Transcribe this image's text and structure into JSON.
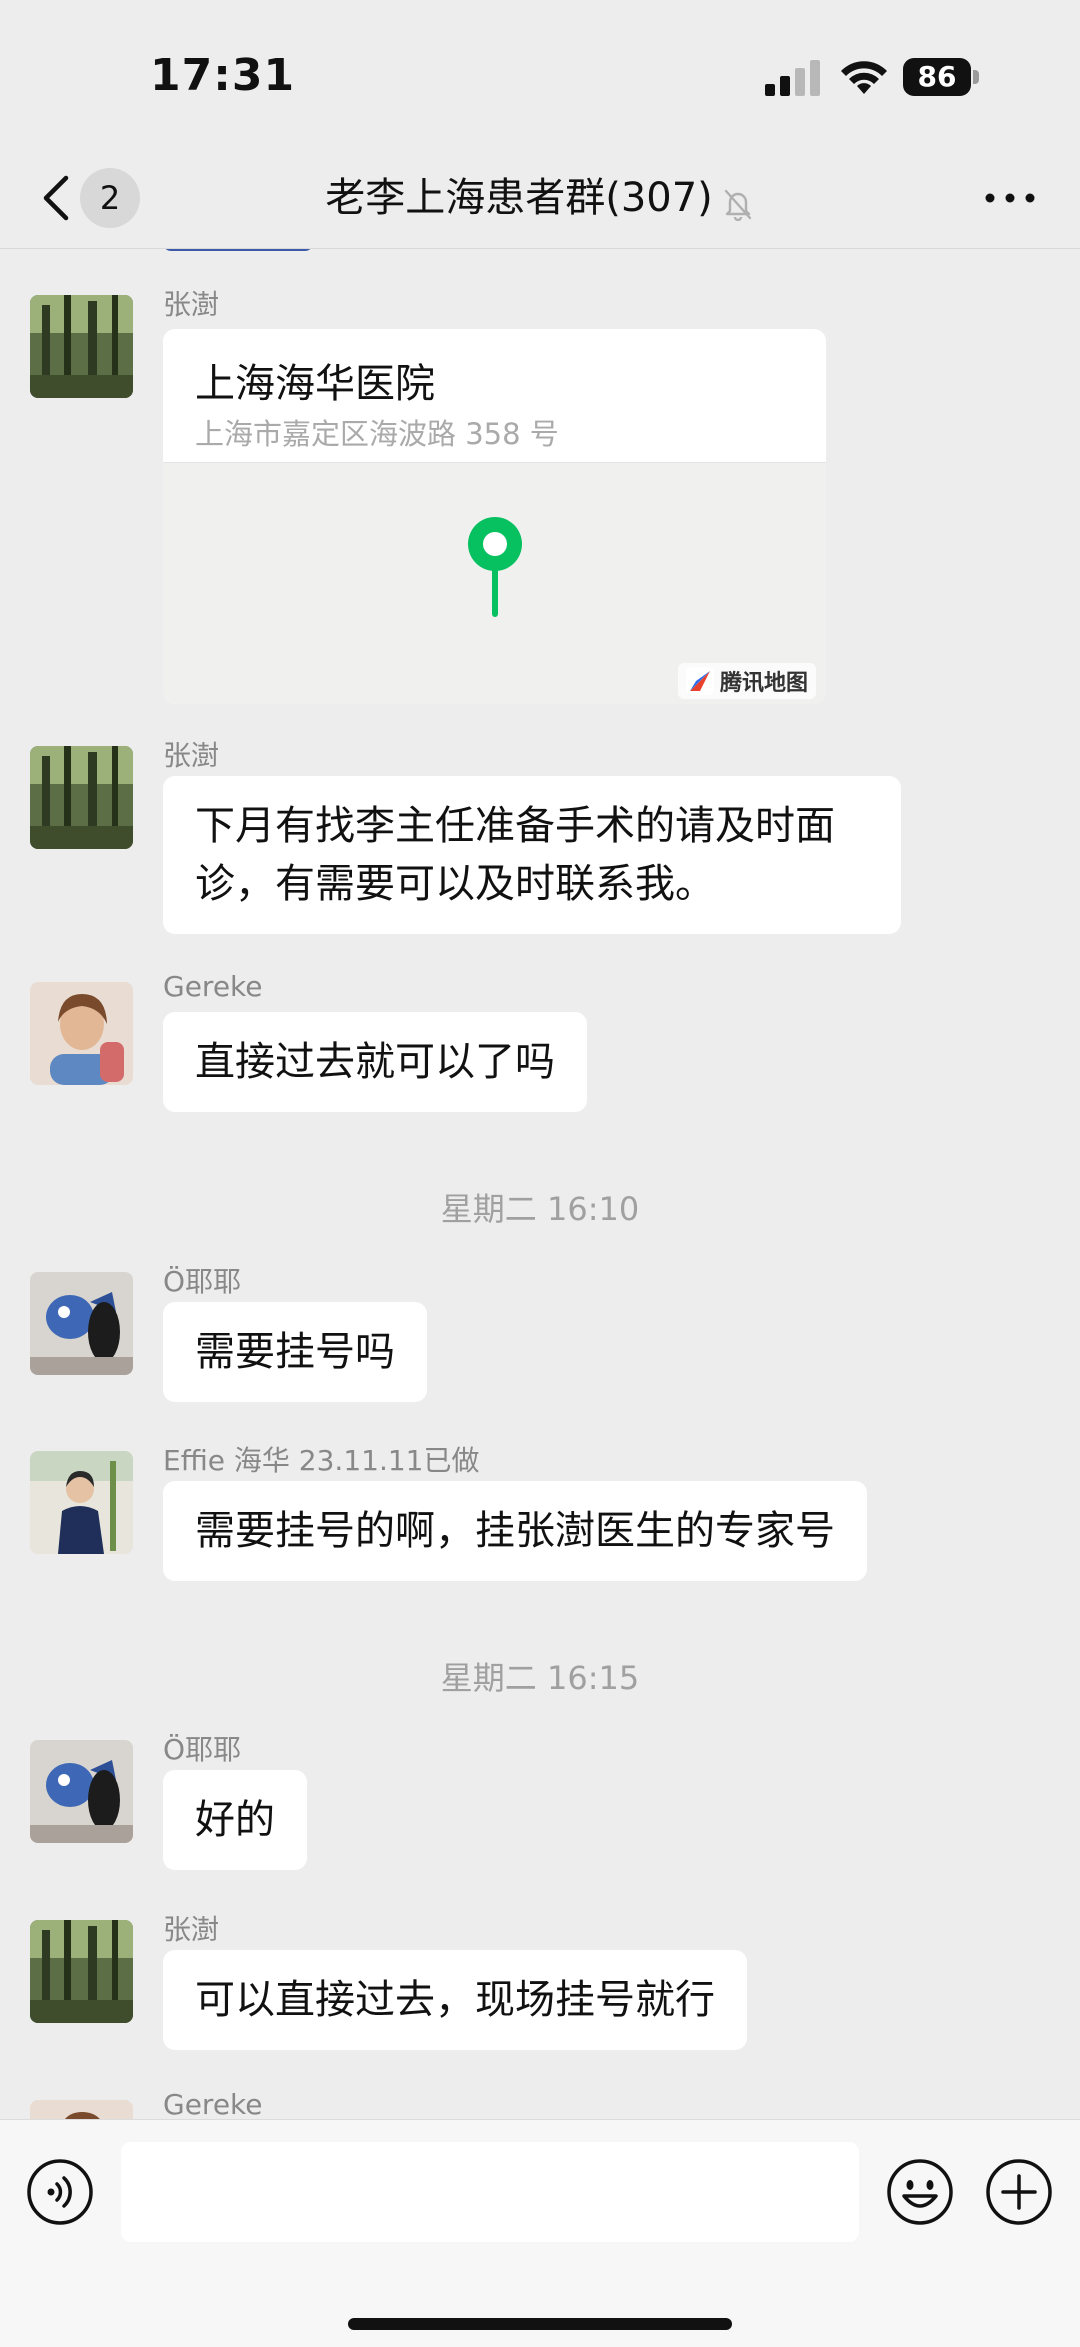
{
  "status_bar": {
    "time": "17:31",
    "battery": "86"
  },
  "nav": {
    "unread_count": "2",
    "title": "老李上海患者群(307)"
  },
  "messages": [
    {
      "sender": "张澍",
      "type": "location",
      "location": {
        "name": "上海海华医院",
        "address": "上海市嘉定区海波路 358 号",
        "map_brand": "腾讯地图"
      }
    },
    {
      "sender": "张澍",
      "type": "text",
      "text_lines": [
        "下月有找李主任准备手术的请及时面",
        "诊，有需要可以及时联系我。"
      ]
    },
    {
      "sender": "Gereke",
      "type": "text",
      "text": "直接过去就可以了吗"
    },
    {
      "type": "time",
      "text": "星期二 16:10"
    },
    {
      "sender": "Ö耶耶",
      "type": "text",
      "text": "需要挂号吗"
    },
    {
      "sender": "Effie 海华 23.11.11已做",
      "type": "text",
      "text": "需要挂号的啊，挂张澍医生的专家号"
    },
    {
      "type": "time",
      "text": "星期二 16:15"
    },
    {
      "sender": "Ö耶耶",
      "type": "text",
      "text": "好的"
    },
    {
      "sender": "张澍",
      "type": "text",
      "text": "可以直接过去，现场挂号就行"
    },
    {
      "sender": "Gereke",
      "type": "text",
      "text": ""
    }
  ],
  "input": {
    "placeholder": ""
  },
  "colors": {
    "background": "#ededed",
    "bubble": "#ffffff",
    "map_pin": "#07c160",
    "sender_text": "#888888"
  }
}
